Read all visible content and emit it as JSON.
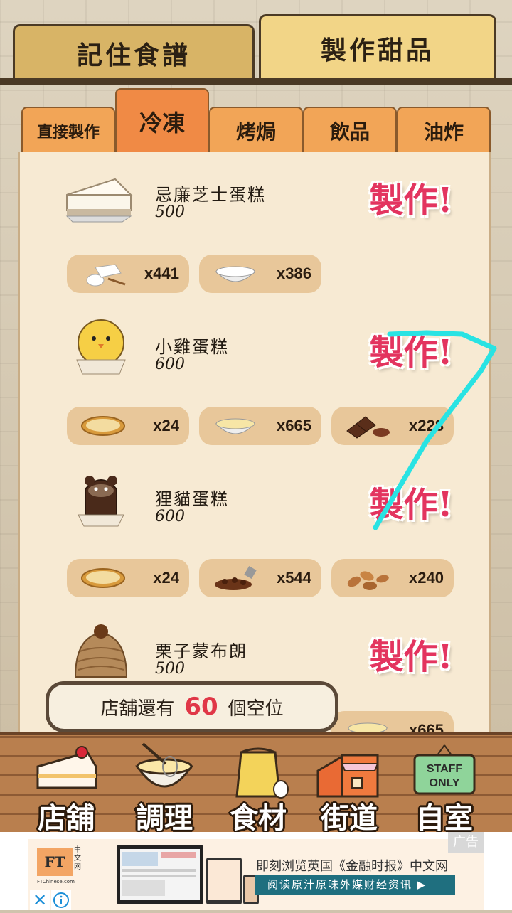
{
  "top_tabs": {
    "recipes": "記住食譜",
    "make_dessert": "製作甜品"
  },
  "categories": [
    "直接製作",
    "冷凍",
    "烤焗",
    "飲品",
    "油炸"
  ],
  "make_label": "製作!",
  "recipes": [
    {
      "name": "忌廉芝士蛋糕",
      "price": "500",
      "ingredients": [
        {
          "icon": "cream-cheese-icon",
          "count": "x441"
        },
        {
          "icon": "whipped-cream-bowl-icon",
          "count": "x386"
        }
      ]
    },
    {
      "name": "小雞蛋糕",
      "price": "600",
      "ingredients": [
        {
          "icon": "tart-shell-icon",
          "count": "x24"
        },
        {
          "icon": "custard-bowl-icon",
          "count": "x665"
        },
        {
          "icon": "chocolate-icon",
          "count": "x228"
        }
      ]
    },
    {
      "name": "狸貓蛋糕",
      "price": "600",
      "ingredients": [
        {
          "icon": "tart-shell-icon",
          "count": "x24"
        },
        {
          "icon": "chocolate-chips-icon",
          "count": "x544"
        },
        {
          "icon": "almond-icon",
          "count": "x240"
        }
      ]
    },
    {
      "name": "栗子蒙布朗",
      "price": "500",
      "ingredients": [
        {
          "icon": "tart-shell-icon",
          "count": ""
        },
        {
          "icon": "custard-bowl-icon",
          "count": "x665"
        }
      ]
    }
  ],
  "seat_banner": {
    "prefix": "店舖還有",
    "count": "60",
    "suffix": "個空位"
  },
  "nav": [
    "店舖",
    "調理",
    "食材",
    "街道",
    "自室"
  ],
  "nav_sign": {
    "line1": "STAFF",
    "line2": "ONLY"
  },
  "ad": {
    "logo": "FT",
    "logo_cn": "中文网",
    "domain": "FTChinese.com",
    "headline": "即刻浏览英国《金融时报》中文网",
    "cta": "阅读原汁原味外媒财经资讯 ▶",
    "tag": "广告",
    "close": "✕"
  },
  "colors": {
    "make": "#e3345f",
    "seat_count": "#e03747",
    "swipe": "#29e3e3"
  }
}
